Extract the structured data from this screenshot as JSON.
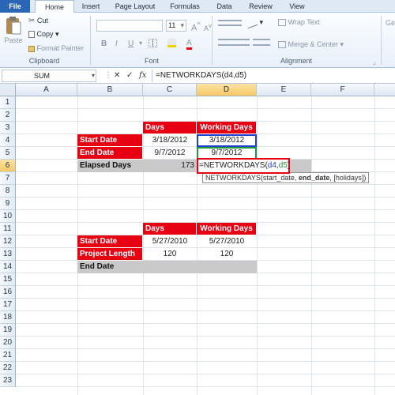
{
  "tabs": {
    "file": "File",
    "home": "Home",
    "insert": "Insert",
    "page_layout": "Page Layout",
    "formulas": "Formulas",
    "data": "Data",
    "review": "Review",
    "view": "View"
  },
  "ribbon": {
    "paste": "Paste",
    "cut": "Cut",
    "copy": "Copy",
    "format_painter": "Format Painter",
    "clipboard": "Clipboard",
    "font": "Font",
    "alignment": "Alignment",
    "font_size": "11",
    "bold": "B",
    "italic": "I",
    "underline": "U",
    "grow_font": "A",
    "shrink_font": "A",
    "wrap_text": "Wrap Text",
    "merge_center": "Merge & Center",
    "ge": "Ge"
  },
  "formula_bar": {
    "name_box": "SUM",
    "cancel": "✕",
    "enter": "✓",
    "fx": "fx",
    "formula": "=NETWORKDAYS(d4,d5)"
  },
  "columns": [
    "A",
    "B",
    "C",
    "D",
    "E",
    "F"
  ],
  "rows": [
    "1",
    "2",
    "3",
    "4",
    "5",
    "6",
    "7",
    "8",
    "9",
    "10",
    "11",
    "12",
    "13",
    "14",
    "15",
    "16",
    "17",
    "18",
    "19",
    "20",
    "21",
    "22",
    "23"
  ],
  "table1": {
    "h_days": "Days",
    "h_working": "Working Days",
    "start_label": "Start Date",
    "start_days": "3/18/2012",
    "start_working": "3/18/2012",
    "end_label": "End Date",
    "end_days": "9/7/2012",
    "end_working": "9/7/2012",
    "elapsed_label": "Elapsed Days",
    "elapsed_value": "173",
    "edit_prefix": "=NETWORKDAYS(",
    "edit_arg1": "d4",
    "edit_comma": ",",
    "edit_arg2": "d5",
    "edit_suffix": ")"
  },
  "tooltip": {
    "fn": "NETWORKDAYS(start_date, ",
    "arg": "end_date",
    "rest": ", [holidays])"
  },
  "table2": {
    "h_days": "Days",
    "h_working": "Working Days",
    "start_label": "Start Date",
    "start_days": "5/27/2010",
    "start_working": "5/27/2010",
    "length_label": "Project Length",
    "length_days": "120",
    "length_working": "120",
    "end_label": "End Date"
  },
  "colors": {
    "accent_red": "#e60012",
    "select_blue": "#1f3fd0",
    "edit_border": "#e60012"
  }
}
